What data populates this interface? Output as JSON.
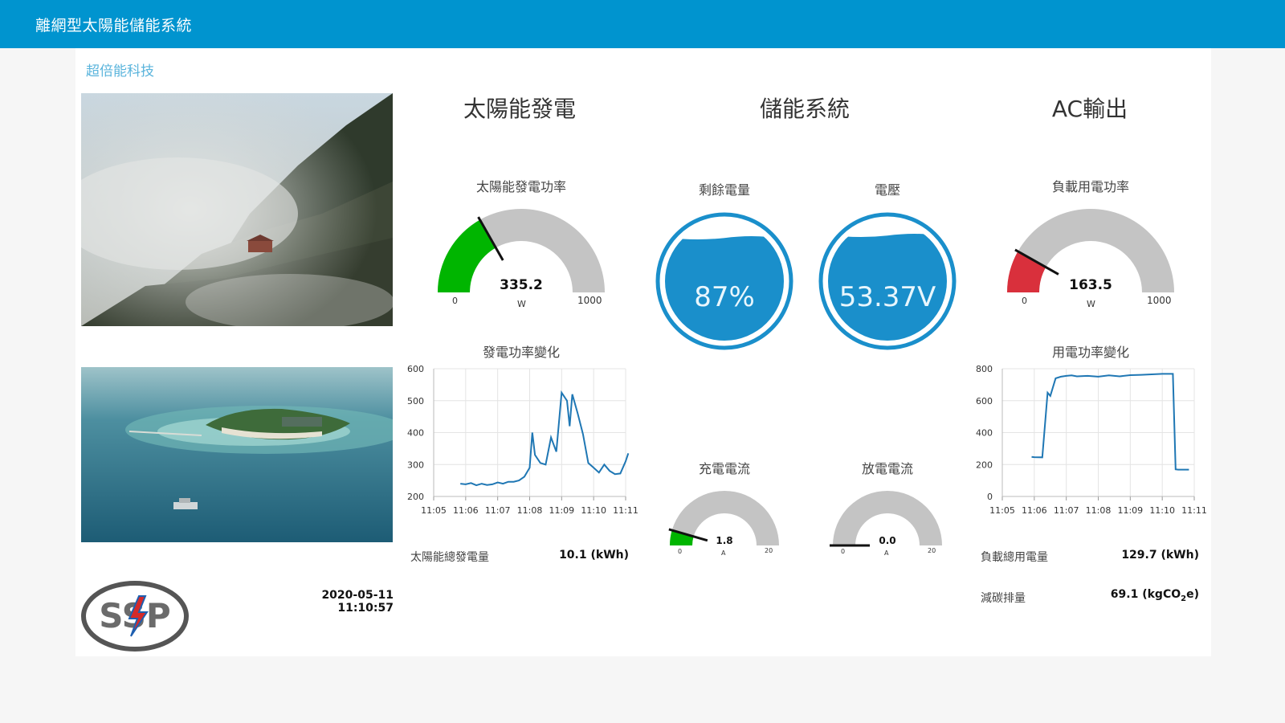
{
  "header": {
    "title": "離網型太陽能儲能系統"
  },
  "brand": {
    "name": "超倍能科技"
  },
  "logo": {
    "text": "SSP"
  },
  "timestamp": "2020-05-11 11:10:57",
  "sections": {
    "solar": "太陽能發電",
    "storage": "儲能系統",
    "ac": "AC輸出"
  },
  "solar_gauge": {
    "label": "太陽能發電功率",
    "value": "335.2",
    "unit": "W",
    "min": "0",
    "max": "1000",
    "fraction": 0.3352,
    "color": "#00b500"
  },
  "load_gauge": {
    "label": "負載用電功率",
    "value": "163.5",
    "unit": "W",
    "min": "0",
    "max": "1000",
    "fraction": 0.1635,
    "color": "#d9303c"
  },
  "charge_gauge": {
    "label": "充電電流",
    "value": "1.8",
    "unit": "A",
    "min": "0",
    "max": "20",
    "fraction": 0.09,
    "color": "#00b500"
  },
  "discharge_gauge": {
    "label": "放電電流",
    "value": "0.0",
    "unit": "A",
    "min": "0",
    "max": "20",
    "fraction": 0.0,
    "color": "#00b500"
  },
  "soc_tank": {
    "label": "剩餘電量",
    "value": "87%",
    "fill": 0.87
  },
  "voltage_tank": {
    "label": "電壓",
    "value": "53.37V",
    "fill": 0.89
  },
  "solar_chart_title": "發電功率變化",
  "load_chart_title": "用電功率變化",
  "solar_total": {
    "label": "太陽能總發電量",
    "value": "10.1 (kWh)"
  },
  "load_total": {
    "label": "負載總用電量",
    "value": "129.7 (kWh)"
  },
  "carbon": {
    "label": "減碳排量",
    "value_main": "69.1 (kgCO",
    "value_sub": "2",
    "value_end": "e)"
  },
  "chart_data": [
    {
      "type": "line",
      "title": "發電功率變化",
      "x_ticks": [
        "11:05",
        "11:06",
        "11:07",
        "11:08",
        "11:09",
        "11:10",
        "11:11"
      ],
      "y_ticks": [
        "200",
        "300",
        "400",
        "500",
        "600"
      ],
      "ylim": [
        200,
        600
      ],
      "grid": true,
      "x": [
        "11:05:50",
        "11:06:00",
        "11:06:10",
        "11:06:20",
        "11:06:30",
        "11:06:40",
        "11:06:50",
        "11:07:00",
        "11:07:10",
        "11:07:20",
        "11:07:30",
        "11:07:40",
        "11:07:50",
        "11:08:00",
        "11:08:05",
        "11:08:10",
        "11:08:20",
        "11:08:30",
        "11:08:40",
        "11:08:50",
        "11:09:00",
        "11:09:10",
        "11:09:15",
        "11:09:20",
        "11:09:30",
        "11:09:40",
        "11:09:50",
        "11:10:00",
        "11:10:10",
        "11:10:20",
        "11:10:30",
        "11:10:40",
        "11:10:50",
        "11:11:00",
        "11:11:05"
      ],
      "values": [
        240,
        238,
        242,
        235,
        240,
        236,
        238,
        244,
        240,
        246,
        246,
        250,
        262,
        290,
        400,
        330,
        305,
        300,
        385,
        340,
        525,
        500,
        420,
        520,
        460,
        395,
        305,
        290,
        275,
        300,
        280,
        270,
        272,
        310,
        335
      ]
    },
    {
      "type": "line",
      "title": "用電功率變化",
      "x_ticks": [
        "11:05",
        "11:06",
        "11:07",
        "11:08",
        "11:09",
        "11:10",
        "11:11"
      ],
      "y_ticks": [
        "0",
        "200",
        "400",
        "600",
        "800"
      ],
      "ylim": [
        0,
        800
      ],
      "grid": true,
      "x": [
        "11:05:55",
        "11:06:00",
        "11:06:15",
        "11:06:25",
        "11:06:30",
        "11:06:40",
        "11:06:50",
        "11:07:00",
        "11:07:10",
        "11:07:20",
        "11:07:40",
        "11:08:00",
        "11:08:20",
        "11:08:40",
        "11:09:00",
        "11:09:20",
        "11:09:40",
        "11:10:00",
        "11:10:20",
        "11:10:25",
        "11:10:30",
        "11:10:50"
      ],
      "values": [
        248,
        246,
        245,
        650,
        630,
        740,
        750,
        755,
        758,
        752,
        755,
        750,
        758,
        752,
        760,
        762,
        765,
        768,
        768,
        170,
        168,
        168
      ]
    }
  ]
}
